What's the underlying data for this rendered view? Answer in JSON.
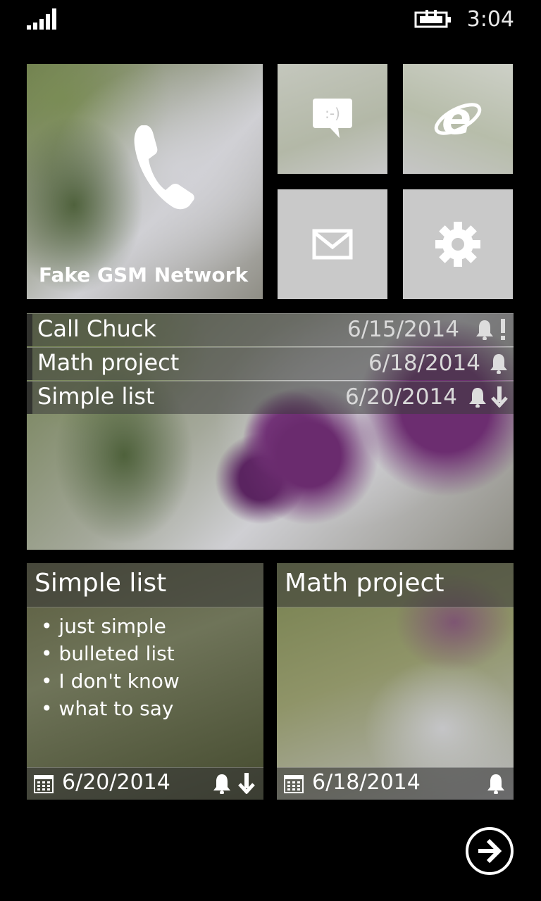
{
  "status_bar": {
    "time": "3:04",
    "signal_icon": "signal-bars-icon",
    "battery_icon": "battery-charging-icon"
  },
  "tiles": {
    "phone": {
      "label": "Fake GSM Network",
      "icon": "phone-icon"
    },
    "messaging": {
      "icon": "messaging-icon"
    },
    "internet_explorer": {
      "icon": "internet-explorer-icon"
    },
    "mail": {
      "icon": "mail-icon"
    },
    "settings": {
      "icon": "gear-icon"
    }
  },
  "tasks_tile": {
    "rows": [
      {
        "title": "Call Chuck",
        "date": "6/15/2014",
        "flags": [
          "bell",
          "exclamation"
        ]
      },
      {
        "title": "Math project",
        "date": "6/18/2014",
        "flags": [
          "bell"
        ]
      },
      {
        "title": "Simple list",
        "date": "6/20/2014",
        "flags": [
          "bell",
          "arrow-down"
        ]
      }
    ]
  },
  "note_tiles": [
    {
      "title": "Simple list",
      "bullets": [
        "• just simple",
        "• bulleted list",
        "• I don't know",
        "• what to say"
      ],
      "date": "6/20/2014",
      "flags": [
        "bell",
        "arrow-down"
      ]
    },
    {
      "title": "Math project",
      "bullets": [],
      "date": "6/18/2014",
      "flags": [
        "bell"
      ]
    }
  ],
  "navigation": {
    "next_icon": "arrow-right-circle-icon"
  },
  "colors": {
    "background": "#000000",
    "tile_text": "#ffffff",
    "accent": "#7a3a80"
  }
}
